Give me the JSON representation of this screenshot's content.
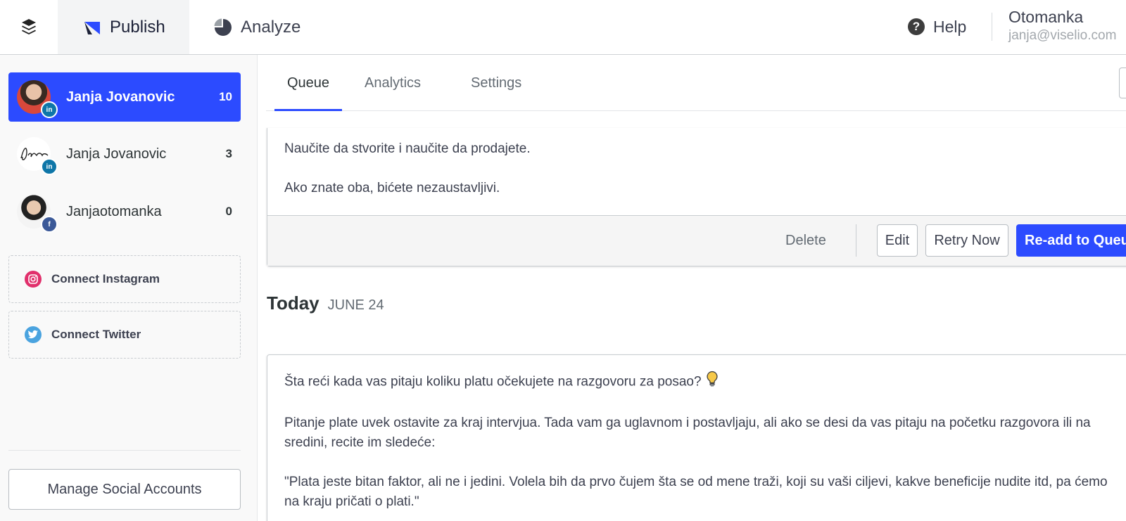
{
  "topbar": {
    "nav": [
      {
        "label": "Publish",
        "icon": "publish-icon",
        "active": true
      },
      {
        "label": "Analyze",
        "icon": "analyze-pie-icon",
        "active": false
      }
    ],
    "help_label": "Help",
    "account_name": "Otomanka",
    "account_email": "janja@viselio.com"
  },
  "sidebar": {
    "profiles": [
      {
        "name": "Janja Jovanovic",
        "count": "10",
        "network": "linkedin",
        "badge": "in",
        "active": true
      },
      {
        "name": "Janja Jovanovic",
        "count": "3",
        "network": "linkedin",
        "badge": "in",
        "active": false
      },
      {
        "name": "Janjaotomanka",
        "count": "0",
        "network": "facebook",
        "badge": "f",
        "active": false
      }
    ],
    "connect": [
      {
        "label": "Connect Instagram",
        "icon": "instagram-icon"
      },
      {
        "label": "Connect Twitter",
        "icon": "twitter-icon"
      }
    ],
    "manage_label": "Manage Social Accounts"
  },
  "main": {
    "tabs": [
      {
        "label": "Queue",
        "active": true
      },
      {
        "label": "Analytics",
        "active": false
      },
      {
        "label": "Settings",
        "active": false
      }
    ],
    "failed_post": {
      "paragraphs": [
        "Naučite da stvorite i naučite da prodajete.",
        "Ako znate oba, bićete nezaustavljivi."
      ],
      "actions": {
        "delete": "Delete",
        "edit": "Edit",
        "retry": "Retry Now",
        "readd": "Re-add to Queue"
      }
    },
    "day": {
      "title": "Today",
      "date": "JUNE 24"
    },
    "post": {
      "paragraphs": [
        "Šta reći kada vas pitaju koliku platu očekujete na razgovoru za posao?",
        "Pitanje plate uvek ostavite za kraj intervjua. Tada vam ga uglavnom i postavljaju, ali ako se desi da vas pitaju na početku razgovora ili na sredini, recite im sledeće:",
        "\"Plata jeste bitan faktor, ali ne i jedini. Volela bih da prvo čujem šta se od mene traži, koji su vaši ciljevi, kakve beneficije nudite itd, pa ćemo na kraju pričati o plati.\""
      ]
    }
  },
  "colors": {
    "accent": "#2c4bff",
    "linkedin": "#0e76a8",
    "facebook": "#3b5998",
    "instagram": "#e1306c",
    "twitter": "#1da1f2"
  }
}
